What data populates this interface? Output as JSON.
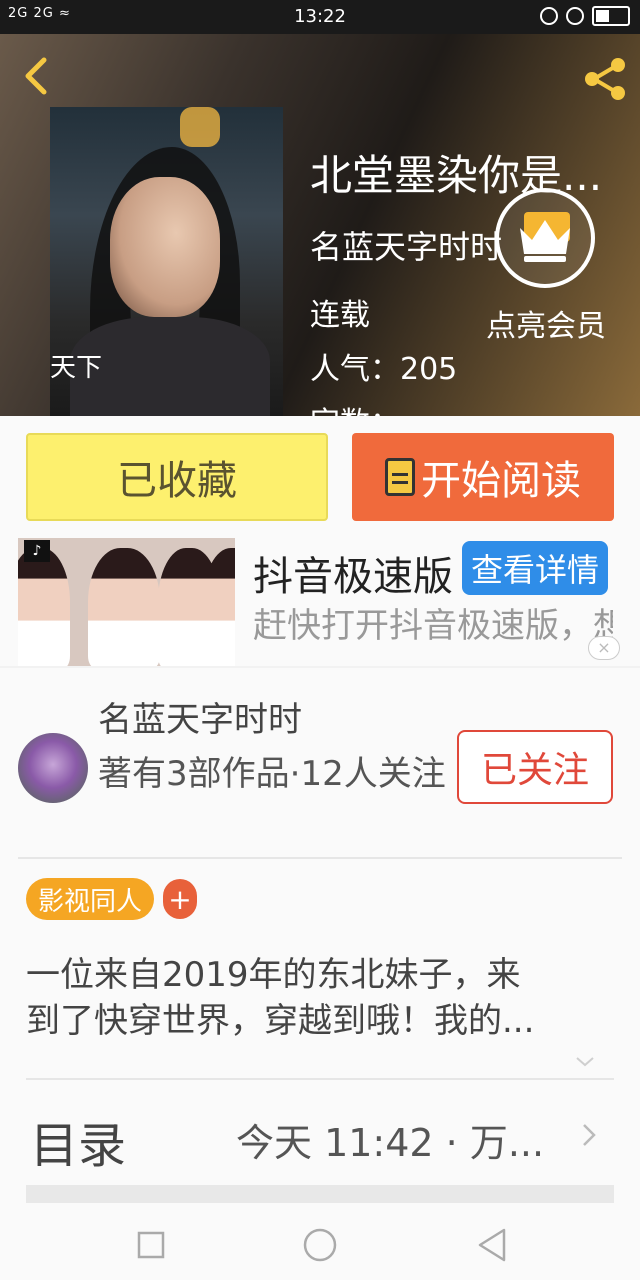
{
  "status_bar": {
    "time": "13:22",
    "network": "2G 2G"
  },
  "book": {
    "title": "北堂墨染你是...",
    "author": "名蓝天字时时",
    "status": "连载",
    "popularity": "人气：205",
    "word_count": "字数："
  },
  "vip": {
    "label": "点亮会员"
  },
  "actions": {
    "favorited_label": "已收藏",
    "read_label": "开始阅读"
  },
  "ad": {
    "title": "抖音极速版",
    "button_label": "查看详情",
    "description": "赶快打开抖音极速版，想看什么随便搜，全",
    "close": "×"
  },
  "author_card": {
    "name": "名蓝天字时时",
    "meta": "著有3部作品·12人关注",
    "follow_label": "已关注"
  },
  "tags": {
    "items": [
      "影视同人"
    ],
    "add": "+"
  },
  "synopsis": {
    "line1": "一位来自2019年的东北妹子，来",
    "line2": "到了快穿世界，穿越到哦！我的..."
  },
  "toc": {
    "label": "目录",
    "meta": "今天 11:42 · 万..."
  },
  "colors": {
    "fav_yellow": "#fdf06e",
    "read_orange": "#f06a3c",
    "ad_blue": "#2f8de8",
    "follow_red": "#e0483a",
    "tag_orange": "#f5a623"
  }
}
